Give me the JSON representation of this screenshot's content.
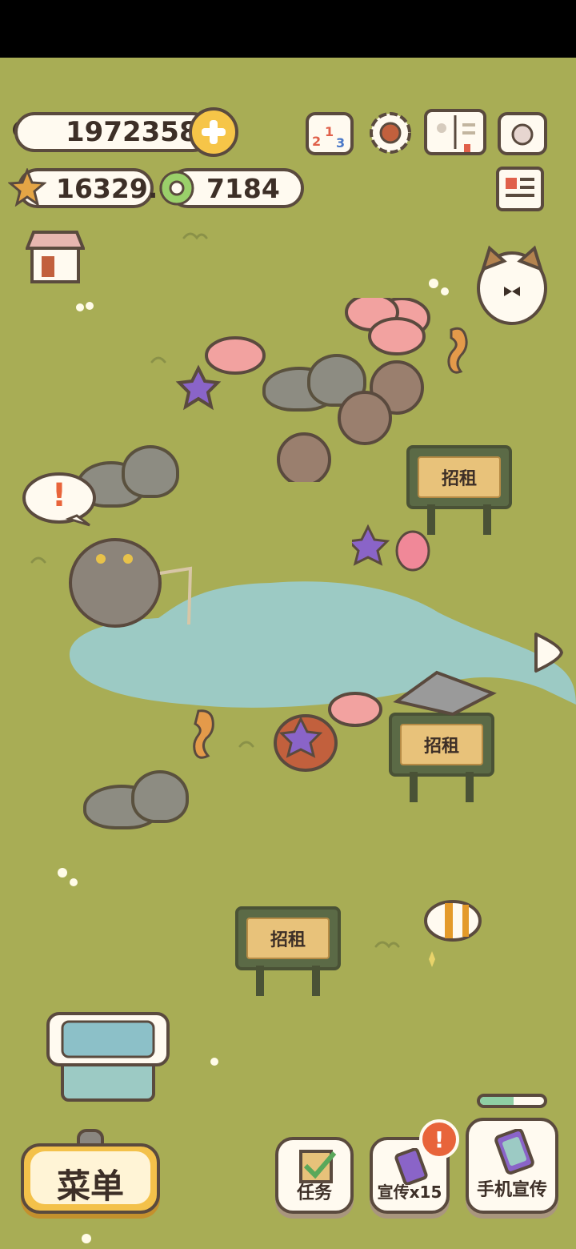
{
  "hud": {
    "fish_currency": "19723589",
    "star_currency": "16329.6",
    "ring_currency": "7184"
  },
  "signs": {
    "rent_label": "招租"
  },
  "bottom_bar": {
    "menu_label": "菜单",
    "tasks_label": "任务",
    "promo_label": "宣传x15",
    "phone_promo_label": "手机宣传",
    "promo_badge": "!"
  },
  "alert": {
    "bubble_text": "!"
  },
  "colors": {
    "grass": "#a8ad55",
    "pond": "#9ccac4",
    "outline": "#5a4a3e",
    "alert_orange": "#e8643a",
    "menu_gold": "#f3c14a"
  }
}
